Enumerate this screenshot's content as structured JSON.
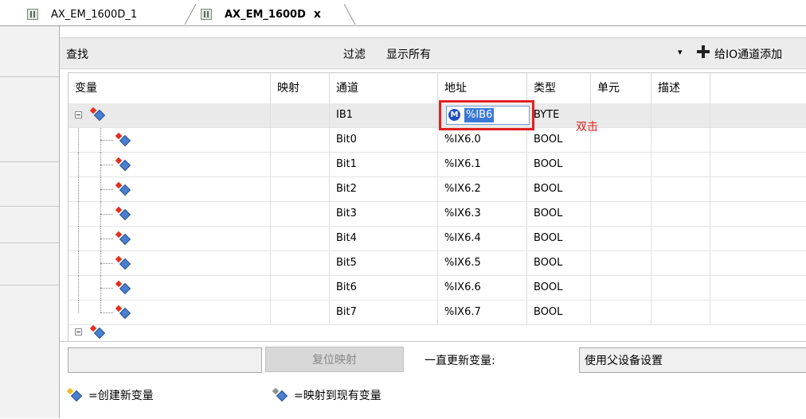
{
  "tabs": [
    {
      "label": "AX_EM_1600D_1",
      "active": false
    },
    {
      "label": "AX_EM_1600D",
      "active": true
    }
  ],
  "close_glyph": "x",
  "filter_bar": {
    "find_label": "查找",
    "filter_label": "过滤",
    "filter_value": "显示所有",
    "dropdown_glyph": "▾",
    "add_button_label": "给IO通道添加"
  },
  "columns": [
    "变量",
    "映射",
    "通道",
    "地址",
    "类型",
    "单元",
    "描述"
  ],
  "rows": [
    {
      "channel": "IB1",
      "address": "%IB6",
      "type": "BYTE",
      "parent": true
    },
    {
      "channel": "Bit0",
      "address": "%IX6.0",
      "type": "BOOL"
    },
    {
      "channel": "Bit1",
      "address": "%IX6.1",
      "type": "BOOL"
    },
    {
      "channel": "Bit2",
      "address": "%IX6.2",
      "type": "BOOL"
    },
    {
      "channel": "Bit3",
      "address": "%IX6.3",
      "type": "BOOL"
    },
    {
      "channel": "Bit4",
      "address": "%IX6.4",
      "type": "BOOL"
    },
    {
      "channel": "Bit5",
      "address": "%IX6.5",
      "type": "BOOL"
    },
    {
      "channel": "Bit6",
      "address": "%IX6.6",
      "type": "BOOL"
    },
    {
      "channel": "Bit7",
      "address": "%IX6.7",
      "type": "BOOL"
    }
  ],
  "editing": {
    "badge": "M",
    "value": "%IB6"
  },
  "annotation": "双击",
  "bottom": {
    "reset_button": "复位映射",
    "always_update_label": "一直更新变量:",
    "always_update_value": "使用父设备设置",
    "legend_create": "=创建新变量",
    "legend_map": "=映射到现有变量"
  },
  "colors": {
    "highlight_border": "#e02020",
    "selection": "#3a78d8",
    "badge": "#2050c0"
  }
}
